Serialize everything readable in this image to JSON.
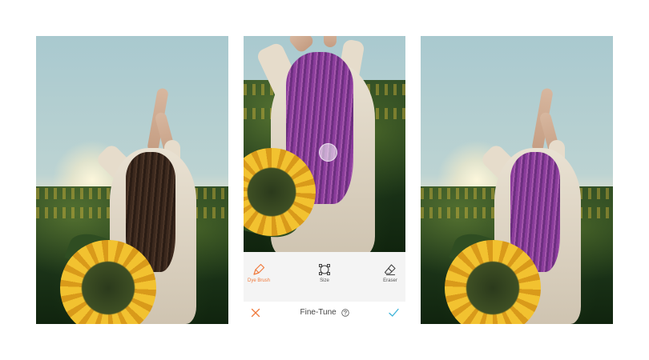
{
  "colors": {
    "accent": "#f07a3c",
    "confirm": "#3bb3d8",
    "toolbar_bg": "#f4f4f4",
    "label_gray": "#555555"
  },
  "panels": {
    "before": {
      "hair_color": "brown"
    },
    "editor": {
      "hair_color": "purple"
    },
    "after": {
      "hair_color": "purple"
    }
  },
  "editor": {
    "tools": [
      {
        "id": "dye-brush",
        "label": "Dye Brush",
        "icon": "brush-icon",
        "active": true
      },
      {
        "id": "size",
        "label": "Size",
        "icon": "size-icon",
        "active": false
      },
      {
        "id": "eraser",
        "label": "Eraser",
        "icon": "eraser-icon",
        "active": false
      }
    ],
    "footer": {
      "title": "Fine-Tune",
      "cancel_icon": "close-icon",
      "help_icon": "help-icon",
      "confirm_icon": "checkmark-icon"
    }
  }
}
